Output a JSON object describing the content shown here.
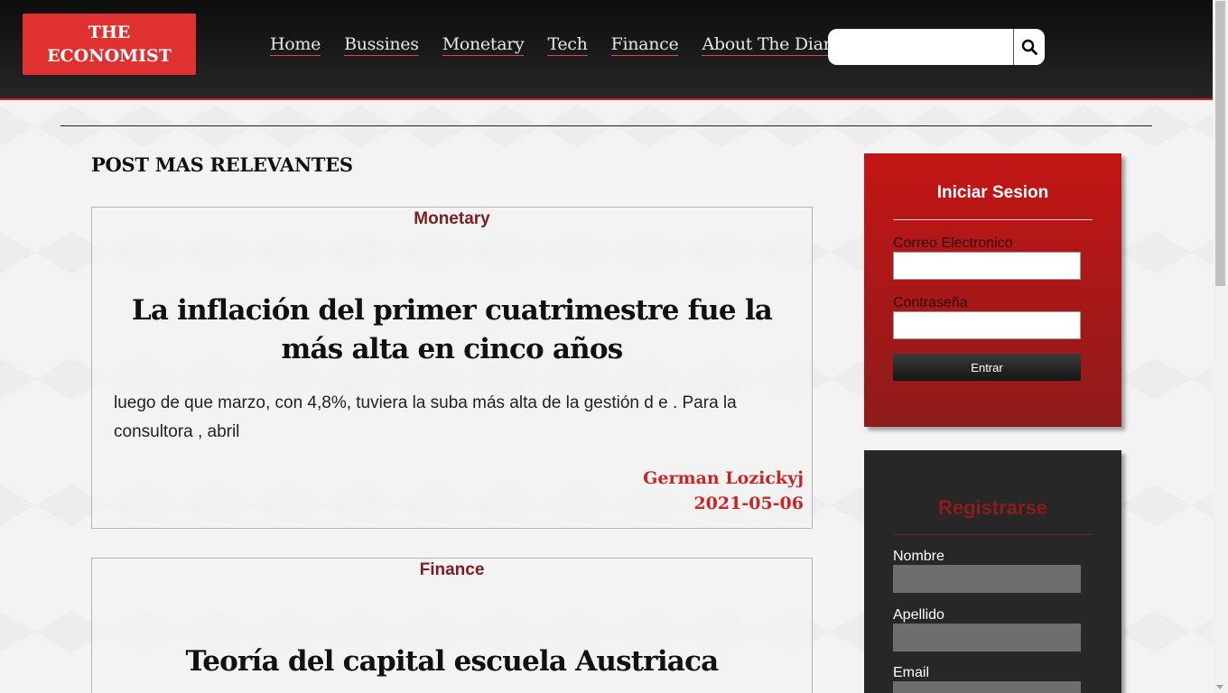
{
  "header": {
    "logo_line1": "THE",
    "logo_line2": "ECONOMIST",
    "nav": [
      "Home",
      "Bussines",
      "Monetary",
      "Tech",
      "Finance",
      "About The Diary"
    ],
    "search": {
      "value": "",
      "icon": "search-icon"
    }
  },
  "main": {
    "section_title": "POST MAS RELEVANTES",
    "posts": [
      {
        "category": "Monetary",
        "title": "La inflación del primer cuatrimestre fue la más alta en cinco años",
        "excerpt": "luego de que marzo, con 4,8%, tuviera la suba más alta de la gestión d e . Para la consultora , abril",
        "author": "German Lozickyj",
        "date": "2021-05-06"
      },
      {
        "category": "Finance",
        "title": "Teoría del capital escuela Austriaca"
      }
    ]
  },
  "login": {
    "title": "Iniciar Sesion",
    "email_label": "Correo Electronico",
    "password_label": "Contraseña",
    "submit_label": "Entrar"
  },
  "register": {
    "title": "Registrarse",
    "name_label": "Nombre",
    "lastname_label": "Apellido",
    "email_label": "Email"
  },
  "colors": {
    "accent": "#e03131",
    "header_bg": "#1a1a1a",
    "category": "#7a1f1f",
    "author": "#c62828"
  }
}
